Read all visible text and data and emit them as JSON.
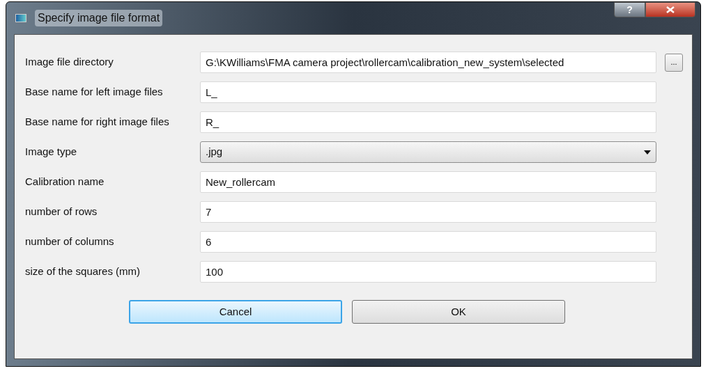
{
  "window": {
    "title": "Specify image file format",
    "help": "?"
  },
  "fields": [
    {
      "label": "Image file directory",
      "kind": "text",
      "value": "G:\\KWilliams\\FMA camera project\\rollercam\\calibration_new_system\\selected",
      "browse": "..."
    },
    {
      "label": "Base name for left image files",
      "kind": "text",
      "value": "L_"
    },
    {
      "label": "Base name for right image files",
      "kind": "text",
      "value": "R_"
    },
    {
      "label": "Image type",
      "kind": "dropdown",
      "value": ".jpg"
    },
    {
      "label": "Calibration name",
      "kind": "text",
      "value": "New_rollercam"
    },
    {
      "label": "number of rows",
      "kind": "text",
      "value": "7"
    },
    {
      "label": "number of columns",
      "kind": "text",
      "value": "6"
    },
    {
      "label": "size of the squares (mm)",
      "kind": "text",
      "value": "100"
    }
  ],
  "buttons": [
    {
      "label": "Cancel",
      "focused": true
    },
    {
      "label": "OK",
      "focused": false
    }
  ]
}
